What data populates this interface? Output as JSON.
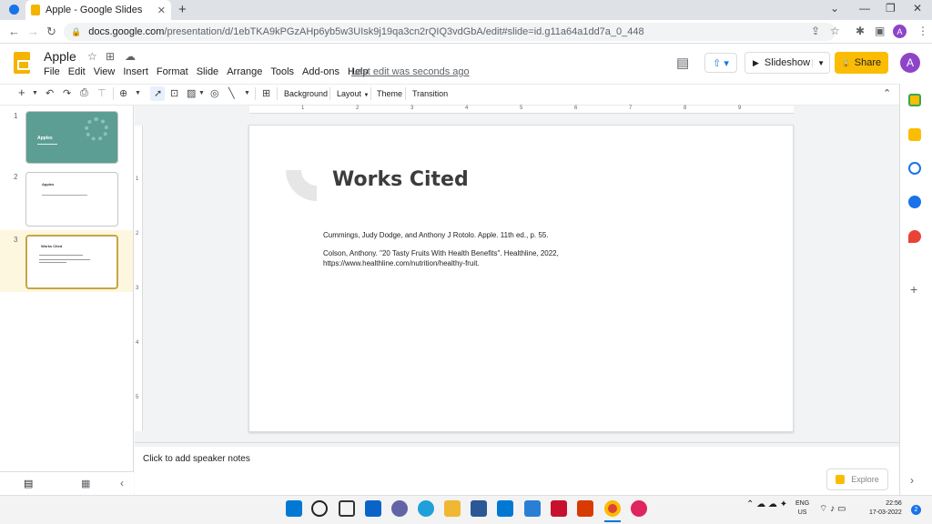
{
  "browser": {
    "tab_title": "Apple - Google Slides",
    "tab_close": "✕",
    "new_tab": "+",
    "url_host": "docs.google.com",
    "url_path": "/presentation/d/1ebTKA9kPGzAHp6yb5w3UIsk9j19qa3cn2rQIQ3vdGbA/edit#slide=id.g11a64a1dd7a_0_448",
    "profile_initial": "A"
  },
  "app": {
    "doc_title": "Apple",
    "menus": [
      "File",
      "Edit",
      "View",
      "Insert",
      "Format",
      "Slide",
      "Arrange",
      "Tools",
      "Add-ons",
      "Help"
    ],
    "last_edit": "Last edit was seconds ago",
    "slideshow_label": "Slideshow",
    "share_label": "Share",
    "avatar_initial": "A"
  },
  "toolbar": {
    "background_label": "Background",
    "layout_label": "Layout",
    "theme_label": "Theme",
    "transition_label": "Transition"
  },
  "ruler": {
    "ticks": [
      "1",
      "2",
      "3",
      "4",
      "5",
      "6",
      "7",
      "8",
      "9"
    ],
    "vticks": [
      "1",
      "2",
      "3",
      "4",
      "5"
    ]
  },
  "filmstrip": {
    "slides": [
      {
        "number": "1",
        "title": "Apples"
      },
      {
        "number": "2",
        "title": "Apples"
      },
      {
        "number": "3",
        "title": "Works Cited"
      }
    ]
  },
  "slide": {
    "title": "Works Cited",
    "citation1": "Cummings, Judy Dodge, and Anthony J Rotolo. Apple. 11th ed., p. 55.",
    "citation2_line1": "Colson, Anthony. \"20 Tasty Fruits With Health Benefits\". Healthline, 2022,",
    "citation2_line2": "https://www.healthline.com/nutrition/healthy-fruit."
  },
  "notes": {
    "placeholder": "Click to add speaker notes"
  },
  "explore_label": "Explore",
  "taskbar": {
    "lang_line1": "ENG",
    "lang_line2": "US",
    "time": "22:56",
    "date": "17-03-2022",
    "notification_count": "2"
  },
  "colors": {
    "accent_yellow": "#fbbc04",
    "brand_blue": "#1a73e8",
    "title_slide_teal": "#5d9e94",
    "selected_slide_border": "#c7a546"
  }
}
